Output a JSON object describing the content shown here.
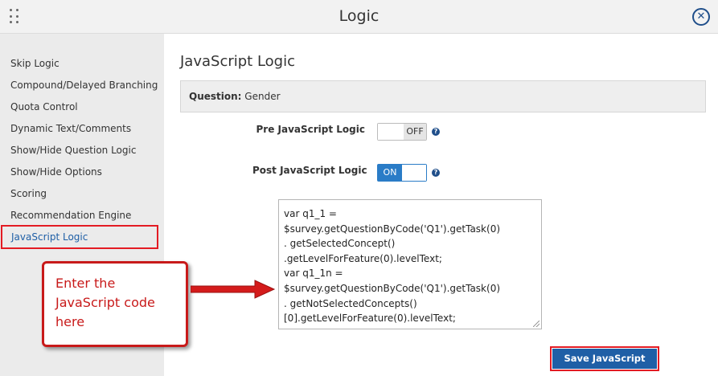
{
  "window": {
    "title": "Logic"
  },
  "icons": {
    "drag": "drag-handle-icon",
    "close": "close-icon",
    "help": "help-icon"
  },
  "sidebar": {
    "items": [
      {
        "label": "Skip Logic"
      },
      {
        "label": "Compound/Delayed Branching"
      },
      {
        "label": "Quota Control"
      },
      {
        "label": "Dynamic Text/Comments"
      },
      {
        "label": "Show/Hide Question Logic"
      },
      {
        "label": "Show/Hide Options"
      },
      {
        "label": "Scoring"
      },
      {
        "label": "Recommendation Engine"
      },
      {
        "label": "JavaScript Logic",
        "active": true
      }
    ]
  },
  "main": {
    "heading": "JavaScript Logic",
    "question_label": "Question:",
    "question_value": "Gender",
    "pre_logic": {
      "label": "Pre JavaScript Logic",
      "state": "OFF"
    },
    "post_logic": {
      "label": "Post JavaScript Logic",
      "state": "ON"
    },
    "code_lines": [
      "var q1_1 =",
      "$survey.getQuestionByCode('Q1').getTask(0)",
      ". getSelectedConcept()",
      ".getLevelForFeature(0).levelText;",
      "var q1_1n =",
      "$survey.getQuestionByCode('Q1').getTask(0)",
      ". getNotSelectedConcepts()",
      "[0].getLevelForFeature(0).levelText;"
    ],
    "save_button": "Save JavaScript Logic"
  },
  "annotation": {
    "callout_text": "Enter the JavaScript code here",
    "color": "#c81a1a"
  }
}
